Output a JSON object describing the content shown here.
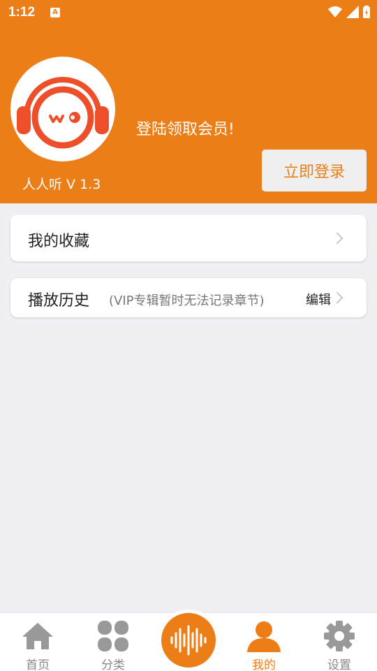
{
  "status_bar": {
    "time": "1:12",
    "notification_icon": "A"
  },
  "header": {
    "app_version": "人人听 V 1.3",
    "login_prompt": "登陆领取会员!",
    "login_button": "立即登录"
  },
  "menu": {
    "favorites": {
      "label": "我的收藏"
    },
    "history": {
      "label": "播放历史",
      "note": "(VIP专辑暂时无法记录章节)",
      "edit_label": "编辑"
    }
  },
  "tabs": [
    {
      "label": "首页",
      "icon": "home-icon"
    },
    {
      "label": "分类",
      "icon": "grid-icon"
    },
    {
      "label": "我的",
      "icon": "profile-icon",
      "active": true
    },
    {
      "label": "设置",
      "icon": "gear-icon"
    }
  ],
  "colors": {
    "accent": "#ec7e17",
    "background": "#efeff4",
    "inactive": "#888888"
  }
}
